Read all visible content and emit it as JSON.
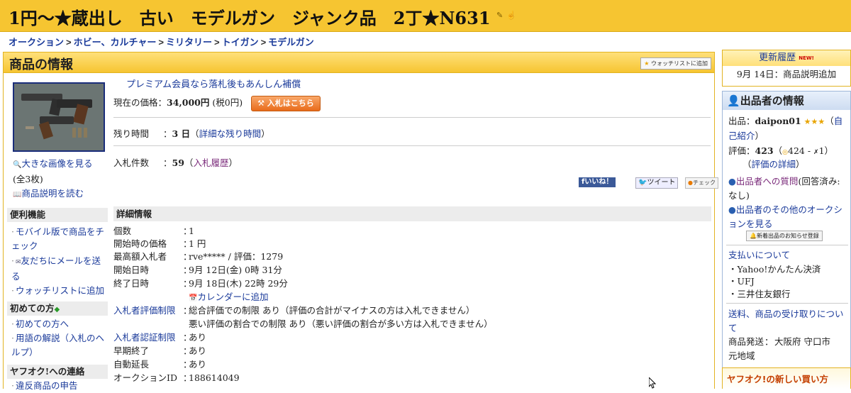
{
  "title": "1円～★蔵出し　古い　モデルガン　ジャンク品　2丁★N631",
  "breadcrumb": [
    "オークション",
    "ホビー、カルチャー",
    "ミリタリー",
    "トイガン",
    "モデルガン"
  ],
  "main": {
    "header": "商品の情報",
    "watchlist_button": "ウォッチリストに追加",
    "premium_link": "プレミアム会員なら落札後もあんしん補償",
    "price_label": "現在の価格",
    "price_value": "34,000円",
    "price_tax": "(税0円)",
    "bid_button": "入札はこちら",
    "remaining_label": "残り時間",
    "remaining_value": "3 日",
    "remaining_link": "詳細な残り時間",
    "bids_label": "入札件数",
    "bids_value": "59",
    "bids_link": "入札履歴",
    "social": {
      "like": "いいね！",
      "tweet": "ツイート",
      "check": "チェック"
    }
  },
  "left": {
    "view_large": "大きな画像を見る",
    "image_count": "(全3枚)",
    "read_desc": "商品説明を読む",
    "tools_header": "便利機能",
    "tools": [
      "モバイル版で商品をチェック",
      "友だちにメールを送る",
      "ウォッチリストに追加"
    ],
    "first_header": "初めての方",
    "first_items": [
      "初めての方へ",
      "用語の解説（入札のヘルプ）"
    ],
    "contact_header": "ヤフオク!への連絡",
    "contact_item": "違反商品の申告"
  },
  "details": {
    "header": "詳細情報",
    "quantity_label": "個数",
    "quantity": "1",
    "start_price_label": "開始時の価格",
    "start_price": "1 円",
    "top_bidder_label": "最高額入札者",
    "top_bidder": "rve***** / 評価：1279",
    "start_label": "開始日時",
    "start": "9月 12日(金) 0時 31分",
    "end_label": "終了日時",
    "end": "9月 18日(木) 22時 29分",
    "calendar": "カレンダーに追加",
    "rating_limit_label": "入札者評価制限",
    "rating_limit_1": "総合評価での制限 あり（評価の合計がマイナスの方は入札できません）",
    "rating_limit_2": "悪い評価の割合での制限 あり（悪い評価の割合が多い方は入札できません）",
    "auth_limit_label": "入札者認証制限",
    "auth_limit": "あり",
    "early_end_label": "早期終了",
    "early_end": "あり",
    "auto_ext_label": "自動延長",
    "auto_ext": "あり",
    "auction_id_label": "オークションID",
    "auction_id": "188614049"
  },
  "right": {
    "update_header": "更新履歴",
    "update_new": "NEW!",
    "update_text": "9月 14日：商品説明追加",
    "seller_header": "出品者の情報",
    "seller_label": "出品",
    "seller_name": "daipon01",
    "self_intro": "自己紹介",
    "rating_label": "評価",
    "rating_value": "423",
    "rating_good": "424",
    "rating_bad": "1",
    "rating_detail": "評価の詳細",
    "question_link": "出品者への質問",
    "question_status": "(回答済み:なし)",
    "other_auctions": "出品者のその他のオークションを見る",
    "notify_button": "新着出品のお知らせ登録",
    "payment_header": "支払いについて",
    "payment_methods": [
      "Yahoo!かんたん決済",
      "UFJ",
      "三井住友銀行"
    ],
    "shipping_header": "送料、商品の受け取りについて",
    "ship_from_label": "商品発送元地域",
    "ship_from": "大阪府 守口市",
    "new_buy": "ヤフオク!の新しい買い方"
  }
}
